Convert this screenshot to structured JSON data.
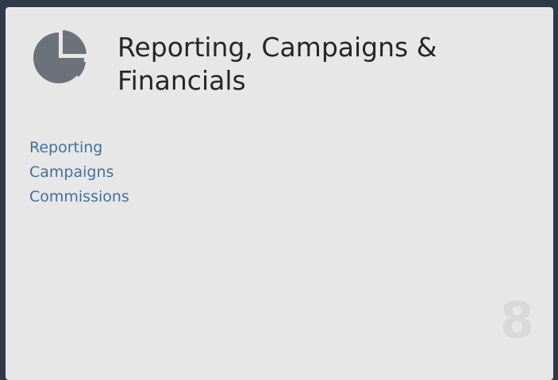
{
  "card": {
    "title": "Reporting, Campaigns & Financials",
    "icon": "pie-chart-icon",
    "links": [
      {
        "label": "Reporting"
      },
      {
        "label": "Campaigns"
      },
      {
        "label": "Commissions"
      }
    ],
    "number": "8"
  },
  "colors": {
    "page_background": "#2e3a48",
    "card_background": "#e7e7e7",
    "icon": "#6c727a",
    "link": "#40719c",
    "title": "#262626",
    "number": "#d9d9d9"
  }
}
